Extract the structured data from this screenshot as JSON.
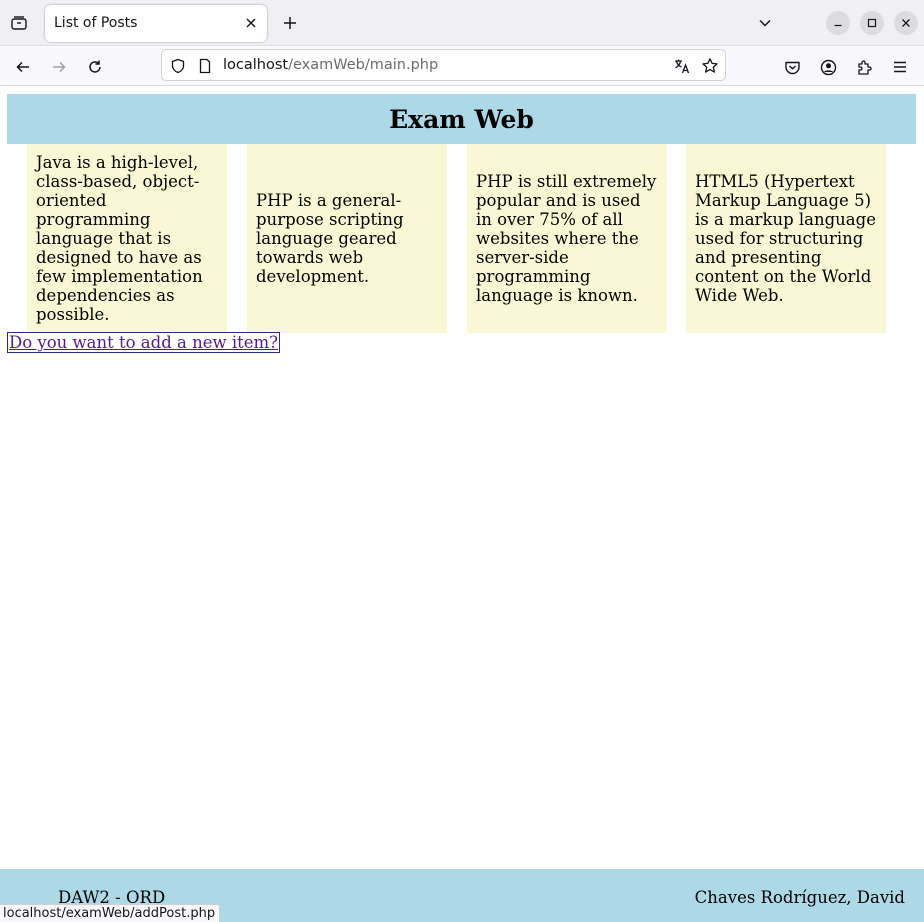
{
  "browser": {
    "tab_title": "List of Posts",
    "url_host": "localhost",
    "url_path": "/examWeb/main.php",
    "icons": {
      "tab_list": "tab-list-icon",
      "tab_close": "close-icon",
      "new_tab": "plus-icon",
      "list_all_tabs": "chevron-down-icon",
      "minimize": "minimize-icon",
      "maximize": "maximize-icon",
      "close_window": "close-icon",
      "back": "back-arrow-icon",
      "forward": "forward-arrow-icon",
      "reload": "reload-icon",
      "tracking_protection": "shield-icon",
      "page_info": "page-icon",
      "translate": "translate-icon",
      "bookmark": "star-icon",
      "pocket": "pocket-icon",
      "account": "account-icon",
      "extensions": "puzzle-icon",
      "menu": "hamburger-menu-icon"
    }
  },
  "page": {
    "header": {
      "title": "Exam Web"
    },
    "posts": [
      "Java is a high-level, class-based, object-oriented programming language that is designed to have as few implementation dependencies as possible.",
      "PHP is a general-purpose scripting language geared towards web development.",
      "PHP is still extremely popular and is used in over 75% of all websites where the server-side programming language is known.",
      "HTML5 (Hypertext Markup Language 5) is a markup language used for structuring and presenting content on the World Wide Web."
    ],
    "add_link": "Do you want to add a new item?",
    "footer": {
      "left": "DAW2 - ORD",
      "right": "Chaves Rodríguez, David"
    }
  },
  "status_bar": {
    "link_preview": "localhost/examWeb/addPost.php"
  },
  "colors": {
    "header_bg": "#add8e6",
    "footer_bg": "#add8e6",
    "post_bg": "#f8f8d4",
    "link_color": "#551a8b"
  }
}
